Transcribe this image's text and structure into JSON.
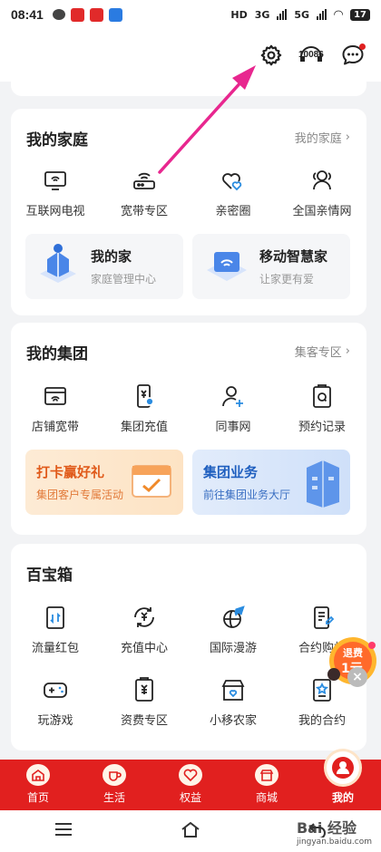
{
  "status": {
    "time": "08:41",
    "hd": "HD",
    "net1": "3G",
    "net2": "5G",
    "battery": "17"
  },
  "topbar": {
    "hotline": "10086"
  },
  "family": {
    "title": "我的家庭",
    "link": "我的家庭",
    "items": [
      {
        "label": "互联网电视",
        "icon": "tv-icon"
      },
      {
        "label": "宽带专区",
        "icon": "router-icon"
      },
      {
        "label": "亲密圈",
        "icon": "hearts-icon"
      },
      {
        "label": "全国亲情网",
        "icon": "people-icon"
      }
    ],
    "promo1": {
      "title": "我的家",
      "subtitle": "家庭管理中心"
    },
    "promo2": {
      "title": "移动智慧家",
      "subtitle": "让家更有爱"
    }
  },
  "group": {
    "title": "我的集团",
    "link": "集客专区",
    "items": [
      {
        "label": "店铺宽带",
        "icon": "shop-wifi-icon"
      },
      {
        "label": "集团充值",
        "icon": "phone-yen-icon"
      },
      {
        "label": "同事网",
        "icon": "add-user-icon"
      },
      {
        "label": "预约记录",
        "icon": "clipboard-icon"
      }
    ],
    "promo1": {
      "title": "打卡赢好礼",
      "subtitle": "集团客户专属活动"
    },
    "promo2": {
      "title": "集团业务",
      "subtitle": "前往集团业务大厅"
    }
  },
  "toolbox": {
    "title": "百宝箱",
    "row1": [
      {
        "label": "流量红包",
        "icon": "data-packet-icon"
      },
      {
        "label": "充值中心",
        "icon": "recharge-icon"
      },
      {
        "label": "国际漫游",
        "icon": "plane-globe-icon"
      },
      {
        "label": "合约购机",
        "icon": "contract-phone-icon"
      }
    ],
    "row2": [
      {
        "label": "玩游戏",
        "icon": "gamepad-icon"
      },
      {
        "label": "资费专区",
        "icon": "tariff-icon"
      },
      {
        "label": "小移农家",
        "icon": "farm-shop-icon"
      },
      {
        "label": "我的合约",
        "icon": "my-contract-icon"
      }
    ]
  },
  "float_ad": {
    "line1": "退费",
    "line2": "1元"
  },
  "tabs": [
    {
      "label": "首页",
      "icon": "home-icon"
    },
    {
      "label": "生活",
      "icon": "cup-icon"
    },
    {
      "label": "权益",
      "icon": "heart-gift-icon"
    },
    {
      "label": "商城",
      "icon": "store-icon"
    },
    {
      "label": "我的",
      "icon": "person-icon"
    }
  ],
  "watermark": {
    "brand": "Bai 经验",
    "url": "jingyan.baidu.com"
  },
  "colors": {
    "brand_red": "#e1201f",
    "arrow": "#e8278f",
    "link_gray": "#888888"
  }
}
